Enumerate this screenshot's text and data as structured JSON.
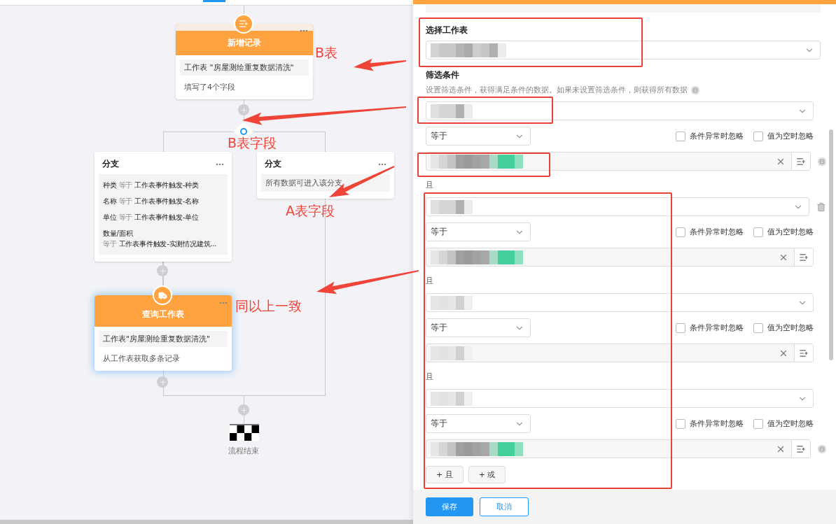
{
  "flow": {
    "add_node": {
      "title": "新增记录",
      "detail": "工作表 \"房屋测绘重复数据清洗\"",
      "summary": "填写了4个字段"
    },
    "branches": [
      {
        "title": "分支",
        "conditions": [
          {
            "kind": "inline",
            "field": "种类",
            "operator": "等于",
            "value": "工作表事件触发-种类"
          },
          {
            "kind": "inline",
            "field": "名称",
            "operator": "等于",
            "value": "工作表事件触发-名称"
          },
          {
            "kind": "inline",
            "field": "单位",
            "operator": "等于",
            "value": "工作表事件触发-单位"
          },
          {
            "kind": "stacked",
            "field": "数量/面积",
            "operator": "等于",
            "value": "工作表事件触发-实测情况建筑..."
          }
        ]
      },
      {
        "title": "分支",
        "note": "所有数据可进入该分支"
      }
    ],
    "query_node": {
      "title": "查询工作表",
      "detail": "工作表\"房屋测绘重复数据清洗\"",
      "summary": "从工作表获取多条记录"
    },
    "end_label": "流程结束"
  },
  "panel": {
    "table_label": "选择工作表",
    "filter_label": "筛选条件",
    "filter_description": "设置筛选条件，获得满足条件的数据。如果未设置筛选条件，则获得所有数据",
    "conditions": [
      {
        "operator": "等于",
        "ignore_error": {
          "label": "条件异常时忽略",
          "checked": false
        },
        "ignore_empty": {
          "label": "值为空时忽略",
          "checked": false
        },
        "deletable": false,
        "info": true
      },
      {
        "joiner": "且",
        "operator": "等于",
        "ignore_error": {
          "label": "条件异常时忽略",
          "checked": false
        },
        "ignore_empty": {
          "label": "值为空时忽略",
          "checked": false
        },
        "deletable": true,
        "info": false
      },
      {
        "joiner": "且",
        "operator": "等于",
        "ignore_error": {
          "label": "条件异常时忽略",
          "checked": false
        },
        "ignore_empty": {
          "label": "值为空时忽略",
          "checked": false
        },
        "deletable": false,
        "info": false
      },
      {
        "joiner": "且",
        "operator": "等于",
        "ignore_error": {
          "label": "条件异常时忽略",
          "checked": false
        },
        "ignore_empty": {
          "label": "值为空时忽略",
          "checked": false
        },
        "deletable": false,
        "info": true
      }
    ],
    "add_buttons": [
      "+ 且",
      "+ 或"
    ],
    "save_button": "保存",
    "cancel_button": "取消"
  },
  "annotations": [
    {
      "text": "B表"
    },
    {
      "text": "B表字段"
    },
    {
      "text": "A表字段"
    },
    {
      "text": "同以上一致"
    }
  ]
}
